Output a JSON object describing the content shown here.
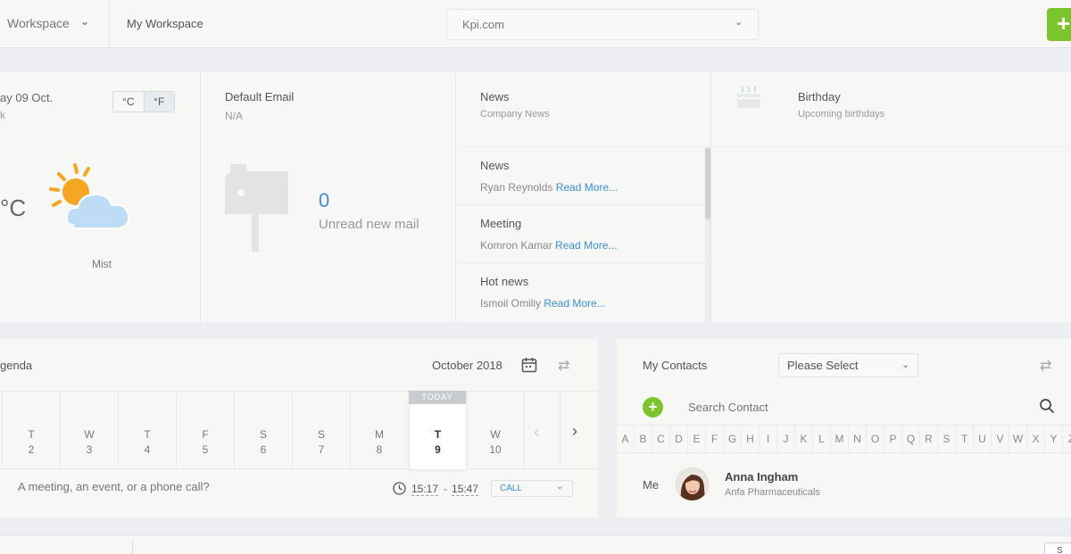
{
  "header": {
    "workspace_select": "Workspace",
    "workspace_title": "My Workspace",
    "domain_select": "Kpi.com",
    "add_button": "+"
  },
  "weather": {
    "date": "ay 09 Oct.",
    "location": "k",
    "unit_c": "°C",
    "unit_f": "°F",
    "temperature": "°C",
    "condition": "Mist"
  },
  "email": {
    "label": "Default Email",
    "value": "N/A",
    "unread_count": "0",
    "unread_label": "Unread new mail"
  },
  "news": {
    "title": "News",
    "subtitle": "Company News",
    "items": [
      {
        "title": "News",
        "author": "Ryan Reynolds",
        "link": "Read More..."
      },
      {
        "title": "Meeting",
        "author": "Komron Kamar",
        "link": "Read More..."
      },
      {
        "title": "Hot news",
        "author": "Ismoil Omiliy",
        "link": "Read More..."
      }
    ]
  },
  "birthday": {
    "title": "Birthday",
    "subtitle": "Upcoming birthdays"
  },
  "agenda": {
    "title": "genda",
    "month": "October 2018",
    "today_tag": "TODAY",
    "days": [
      {
        "name": "T",
        "num": "2"
      },
      {
        "name": "W",
        "num": "3"
      },
      {
        "name": "T",
        "num": "4"
      },
      {
        "name": "F",
        "num": "5"
      },
      {
        "name": "S",
        "num": "6"
      },
      {
        "name": "S",
        "num": "7"
      },
      {
        "name": "M",
        "num": "8"
      },
      {
        "name": "T",
        "num": "9"
      },
      {
        "name": "W",
        "num": "10"
      }
    ],
    "event_placeholder": "A meeting, an event, or a phone call?",
    "time_start": "15:17",
    "time_sep": "-",
    "time_end": "15:47",
    "type_select": "CALL"
  },
  "contacts": {
    "title": "My Contacts",
    "filter_select": "Please Select",
    "search_placeholder": "Search Contact",
    "add_label": "+",
    "alphabet": [
      "A",
      "B",
      "C",
      "D",
      "E",
      "F",
      "G",
      "H",
      "I",
      "J",
      "K",
      "L",
      "M",
      "N",
      "O",
      "P",
      "Q",
      "R",
      "S",
      "T",
      "U",
      "V",
      "W",
      "X",
      "Y",
      "Z"
    ],
    "me_label": "Me",
    "me_name": "Anna Ingham",
    "me_company": "Anfa Pharmaceuticals"
  },
  "footer": {
    "button": "S"
  },
  "colors": {
    "accent_green": "#7cc42b",
    "link_blue": "#3a8fd8"
  }
}
